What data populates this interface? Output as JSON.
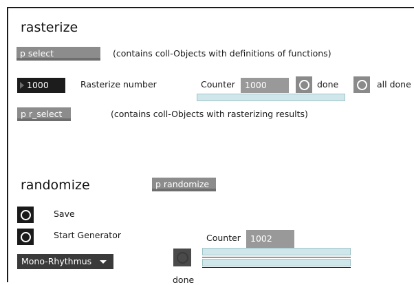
{
  "rasterize": {
    "heading": "rasterize",
    "p_select_label": "p select",
    "p_select_note": "(contains coll-Objects with definitions of functions)",
    "number_value": "1000",
    "rasterize_number_label": "Rasterize number",
    "counter_label": "Counter",
    "counter_value": "1000",
    "done_label": "done",
    "all_done_label": "all done",
    "p_r_select_label": "p r_select",
    "p_r_select_note": "(contains coll-Objects with rasterizing results)"
  },
  "randomize": {
    "heading": "randomize",
    "p_randomize_label": "p randomize",
    "save_label": "Save",
    "start_generator_label": "Start Generator",
    "menu_selected": "Mono-Rhythmus",
    "counter_label": "Counter",
    "counter_value": "1002",
    "done_label": "done"
  },
  "colors": {
    "subpatch": "#8c8c8c",
    "number_box": "#1c1c1c",
    "slider": "#cfe6ea"
  }
}
